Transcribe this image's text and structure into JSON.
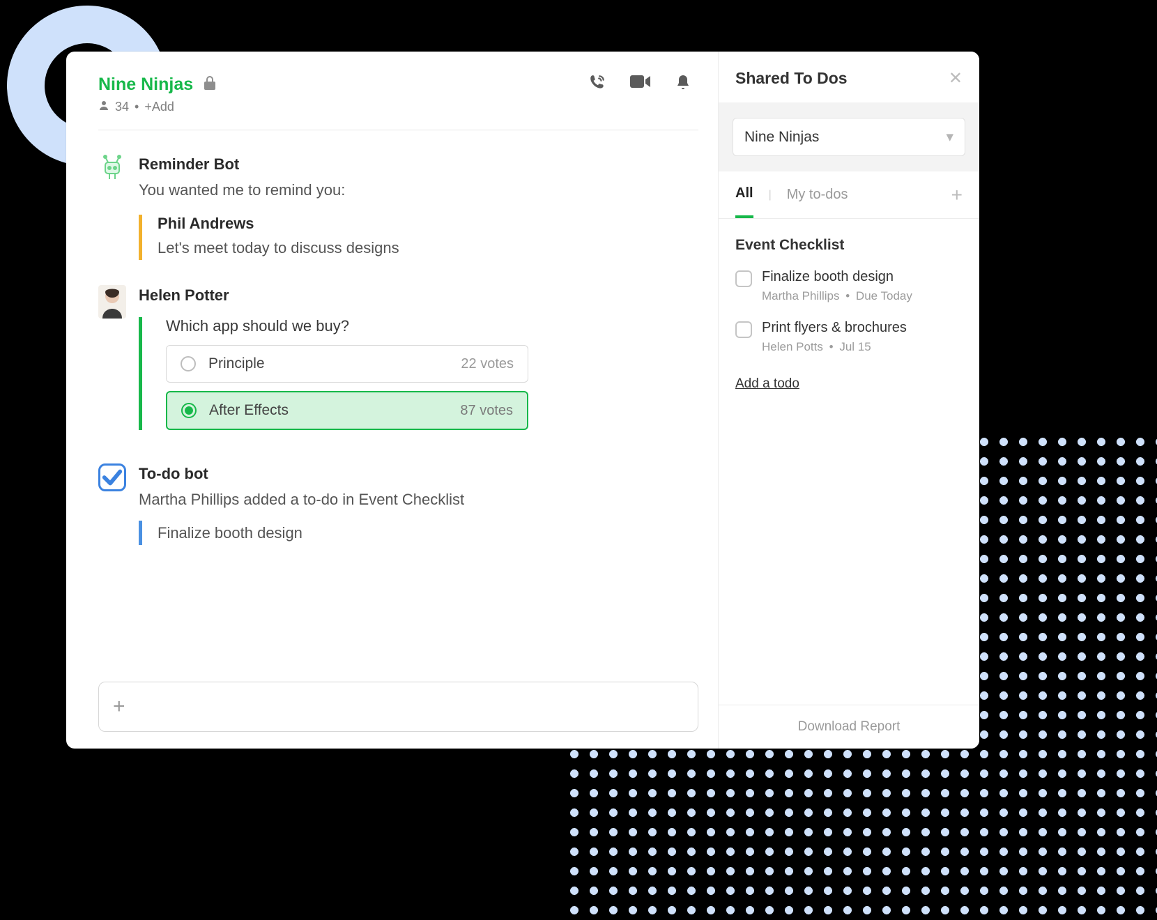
{
  "header": {
    "channel_name": "Nine Ninjas",
    "member_count": "34",
    "add_label": "+Add"
  },
  "messages": {
    "reminder": {
      "sender": "Reminder Bot",
      "text": "You wanted me to remind you:",
      "quote_name": "Phil Andrews",
      "quote_text": "Let's meet today to discuss designs"
    },
    "poll": {
      "sender": "Helen Potter",
      "question": "Which app should we buy?",
      "options": [
        {
          "label": "Principle",
          "votes": "22 votes",
          "selected": false
        },
        {
          "label": "After Effects",
          "votes": "87 votes",
          "selected": true
        }
      ]
    },
    "todobot": {
      "sender": "To-do bot",
      "text": "Martha Phillips added a to-do in Event Checklist",
      "quote_text": "Finalize booth design"
    }
  },
  "panel": {
    "title": "Shared To Dos",
    "dropdown_value": "Nine Ninjas",
    "tabs": {
      "all": "All",
      "mine": "My to-dos"
    },
    "list_title": "Event Checklist",
    "todos": [
      {
        "title": "Finalize booth design",
        "owner": "Martha Phillips",
        "due": "Due Today"
      },
      {
        "title": "Print flyers & brochures",
        "owner": "Helen Potts",
        "due": "Jul 15"
      }
    ],
    "add_label": "Add a todo",
    "download": "Download Report"
  }
}
